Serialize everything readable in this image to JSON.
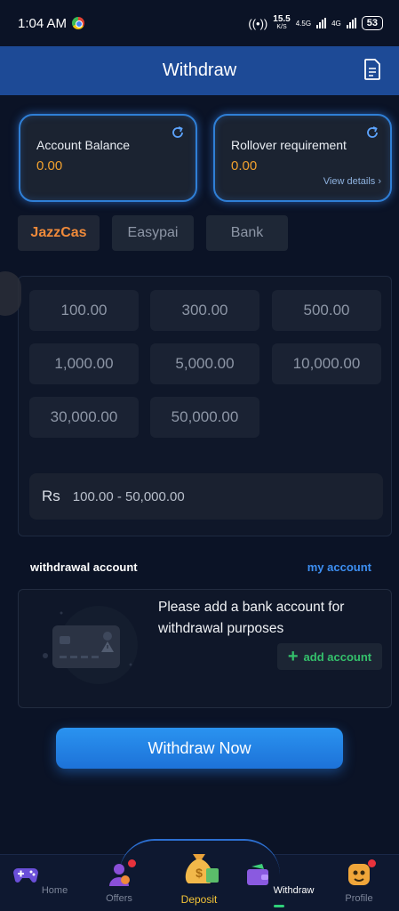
{
  "status_bar": {
    "time": "1:04 AM",
    "speed_value": "15.5",
    "speed_unit": "K/S",
    "net1": "4.5G",
    "net2": "4G",
    "battery": "53"
  },
  "header": {
    "title": "Withdraw"
  },
  "balances": {
    "account_label": "Account Balance",
    "account_value": "0.00",
    "rollover_label": "Rollover requirement",
    "rollover_value": "0.00",
    "view_details": "View details"
  },
  "methods": [
    {
      "label": "JazzCas",
      "active": true
    },
    {
      "label": "Easypai",
      "active": false
    },
    {
      "label": "Bank",
      "active": false
    }
  ],
  "amounts": [
    "100.00",
    "300.00",
    "500.00",
    "1,000.00",
    "5,000.00",
    "10,000.00",
    "30,000.00",
    "50,000.00"
  ],
  "amount_input": {
    "currency": "Rs",
    "placeholder": "100.00 - 50,000.00"
  },
  "withdrawal_account": {
    "title": "withdrawal account",
    "link": "my account",
    "message": "Please add a bank account for withdrawal purposes",
    "add_label": "add account"
  },
  "cta": {
    "label": "Withdraw Now"
  },
  "bottom_nav": {
    "home": "Home",
    "offers": "Offers",
    "deposit": "Deposit",
    "withdraw": "Withdraw",
    "profile": "Profile"
  },
  "colors": {
    "accent": "#2f7fd6",
    "orange": "#f08a3a",
    "green": "#34c06b",
    "header": "#1d4a96"
  }
}
